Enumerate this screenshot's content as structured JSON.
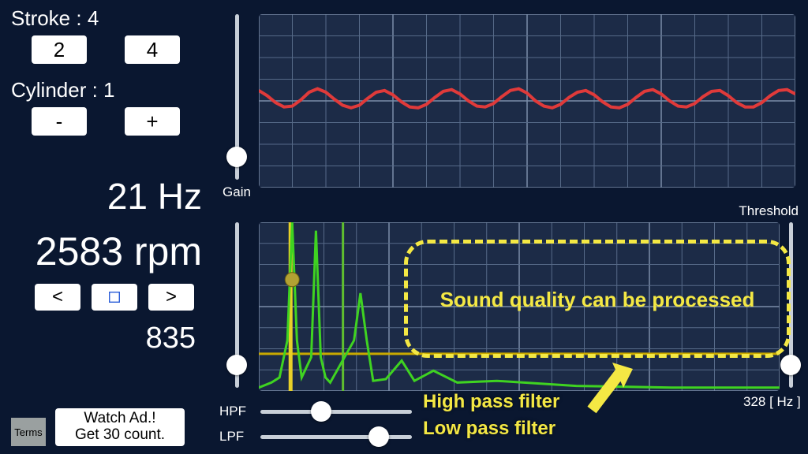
{
  "left": {
    "stroke_label": "Stroke : 4",
    "stroke_2": "2",
    "stroke_4": "4",
    "cylinder_label": "Cylinder : 1",
    "cyl_minus": "-",
    "cyl_plus": "+",
    "hz_readout": "21 Hz",
    "rpm_readout": "2583 rpm",
    "prev": "<",
    "next": ">",
    "count_readout": "835",
    "terms": "Terms",
    "ad_line1": "Watch Ad.!",
    "ad_line2": "Get 30 count."
  },
  "sliders": {
    "gain_label": "Gain",
    "threshold_label": "Threshold",
    "hpf_label": "HPF",
    "lpf_label": "LPF"
  },
  "annotations": {
    "callout": "Sound quality can be processed",
    "hp": "High pass filter",
    "lp": "Low pass filter"
  },
  "scope": {
    "freq_max": "328 [ Hz ]"
  },
  "chart_data": [
    {
      "type": "line",
      "name": "waveform",
      "y": [
        0.12,
        0.06,
        -0.02,
        -0.07,
        -0.06,
        0.01,
        0.1,
        0.14,
        0.1,
        0.02,
        -0.05,
        -0.08,
        -0.05,
        0.03,
        0.1,
        0.12,
        0.07,
        -0.01,
        -0.07,
        -0.08,
        -0.04,
        0.04,
        0.11,
        0.13,
        0.08,
        0.0,
        -0.06,
        -0.07,
        -0.03,
        0.05,
        0.12,
        0.14,
        0.09,
        0.0,
        -0.06,
        -0.08,
        -0.04,
        0.04,
        0.1,
        0.12,
        0.07,
        -0.01,
        -0.07,
        -0.08,
        -0.04,
        0.04,
        0.11,
        0.13,
        0.08,
        0.0,
        -0.06,
        -0.07,
        -0.03,
        0.05,
        0.11,
        0.12,
        0.06,
        -0.02,
        -0.07,
        -0.07,
        -0.02,
        0.06,
        0.12,
        0.13,
        0.08
      ],
      "ylim": [
        -1,
        1
      ]
    },
    {
      "type": "line",
      "name": "spectrum",
      "xlabel": "Hz",
      "xlim": [
        0,
        328
      ],
      "ylim": [
        0,
        1
      ],
      "threshold": 0.22,
      "hpf_hz": 20,
      "lpf_hz": 53,
      "peak_marker_hz": 21,
      "x": [
        0,
        8,
        13,
        18,
        21,
        24,
        27,
        33,
        36,
        39,
        42,
        45,
        60,
        64,
        68,
        72,
        80,
        90,
        98,
        110,
        125,
        150,
        200,
        260,
        328
      ],
      "values": [
        0.02,
        0.05,
        0.08,
        0.3,
        1.0,
        0.3,
        0.08,
        0.2,
        0.95,
        0.2,
        0.08,
        0.05,
        0.3,
        0.58,
        0.3,
        0.06,
        0.07,
        0.18,
        0.06,
        0.12,
        0.05,
        0.06,
        0.03,
        0.02,
        0.02
      ]
    }
  ]
}
